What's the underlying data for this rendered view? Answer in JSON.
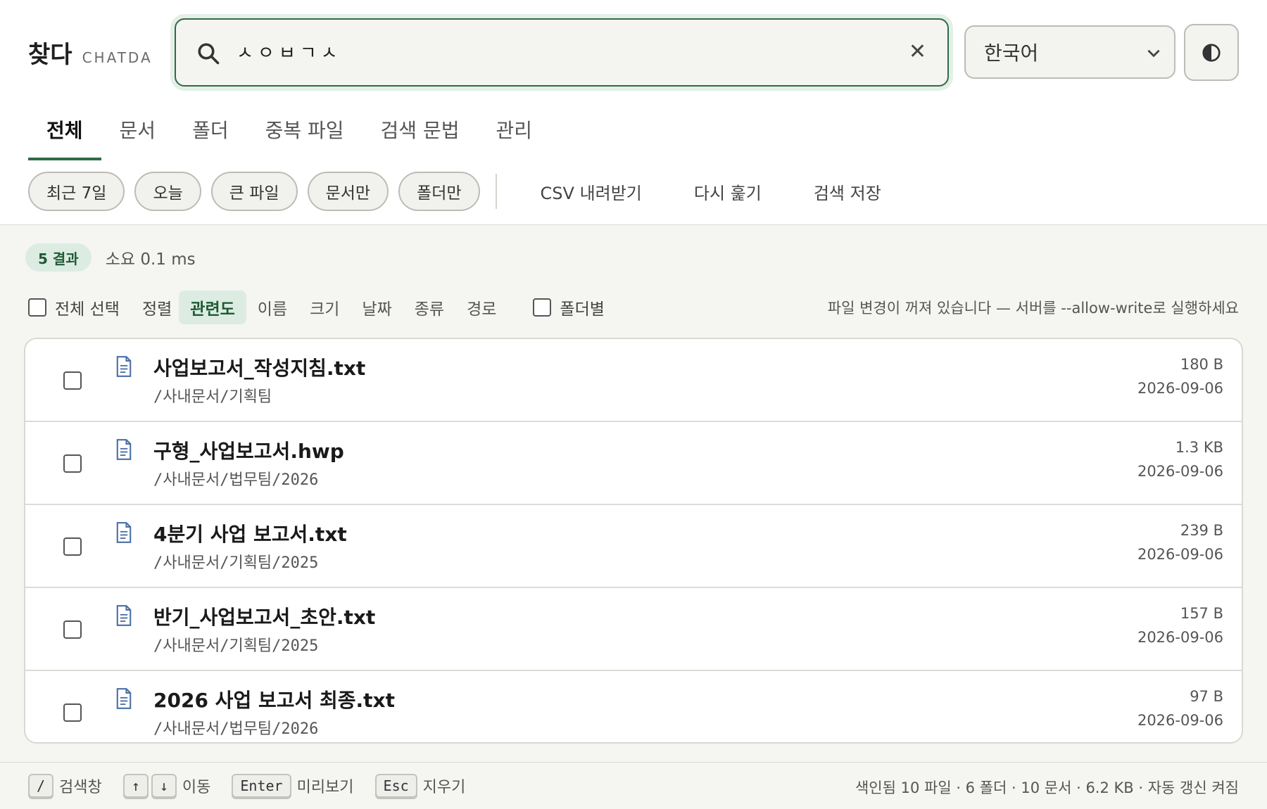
{
  "brand": {
    "name": "찾다",
    "sub": "CHATDA"
  },
  "search": {
    "value": "ㅅㅇㅂㄱㅅ",
    "placeholder": ""
  },
  "language": {
    "selected": "한국어"
  },
  "tabs": [
    {
      "label": "전체",
      "active": true
    },
    {
      "label": "문서"
    },
    {
      "label": "폴더"
    },
    {
      "label": "중복 파일"
    },
    {
      "label": "검색 문법"
    },
    {
      "label": "관리"
    }
  ],
  "filters": [
    "최근 7일",
    "오늘",
    "큰 파일",
    "문서만",
    "폴더만"
  ],
  "actions": [
    "CSV 내려받기",
    "다시 훑기",
    "검색 저장"
  ],
  "results_meta": {
    "count": "5 결과",
    "elapsed": "소요 0.1 ms"
  },
  "sortbar": {
    "select_all": "전체 선택",
    "sort_label": "정렬",
    "sort_options": [
      "관련도",
      "이름",
      "크기",
      "날짜",
      "종류",
      "경로"
    ],
    "active_sort": "관련도",
    "group_by_folder": "폴더별",
    "notice": "파일 변경이 꺼져 있습니다 — 서버를 --allow-write로 실행하세요"
  },
  "results": [
    {
      "name": "사업보고서_작성지침.txt",
      "path": "/사내문서/기획팀",
      "size": "180 B",
      "date": "2026-09-06"
    },
    {
      "name": "구형_사업보고서.hwp",
      "path": "/사내문서/법무팀/2026",
      "size": "1.3 KB",
      "date": "2026-09-06"
    },
    {
      "name": "4분기 사업 보고서.txt",
      "path": "/사내문서/기획팀/2025",
      "size": "239 B",
      "date": "2026-09-06"
    },
    {
      "name": "반기_사업보고서_초안.txt",
      "path": "/사내문서/기획팀/2025",
      "size": "157 B",
      "date": "2026-09-06"
    },
    {
      "name": "2026 사업 보고서 최종.txt",
      "path": "/사내문서/법무팀/2026",
      "size": "97 B",
      "date": "2026-09-06"
    }
  ],
  "footer": {
    "shortcuts": [
      {
        "keys": [
          "/"
        ],
        "label": "검색창"
      },
      {
        "keys": [
          "↑",
          "↓"
        ],
        "label": "이동"
      },
      {
        "keys": [
          "Enter"
        ],
        "label": "미리보기"
      },
      {
        "keys": [
          "Esc"
        ],
        "label": "지우기"
      }
    ],
    "stats": "색인됨 10 파일 · 6 폴더 · 10 문서 · 6.2 KB · 자동 갱신 켜짐"
  },
  "colors": {
    "accent": "#2f6b45",
    "accent_soft": "#dcece2",
    "icon_blue": "#4a6fa5"
  },
  "icons": [
    "search-icon",
    "close-icon",
    "chevron-down-icon",
    "contrast-icon",
    "file-icon"
  ]
}
